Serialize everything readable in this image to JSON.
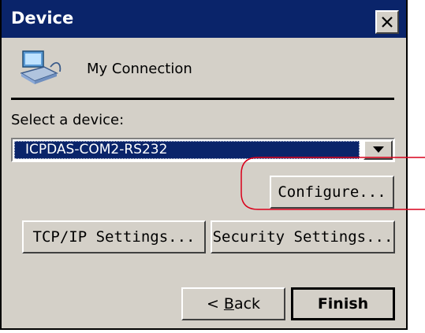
{
  "window": {
    "title": "Device"
  },
  "connection": {
    "name": "My Connection"
  },
  "device_select": {
    "label": "Select a device:",
    "value": "ICPDAS-COM2-RS232"
  },
  "buttons": {
    "configure": "Configure...",
    "tcpip": "TCP/IP Settings...",
    "security": "Security Settings...",
    "back_prefix": "< ",
    "back_mnemonic": "B",
    "back_rest": "ack",
    "finish": "Finish"
  },
  "icons": {
    "close": "close-icon",
    "connection": "network-connection-icon",
    "dropdown": "dropdown-arrow-icon"
  },
  "colors": {
    "titlebar": "#0a246a",
    "dialog_bg": "#d4d0c8",
    "highlight": "#0a246a",
    "callout": "#d9001b"
  }
}
